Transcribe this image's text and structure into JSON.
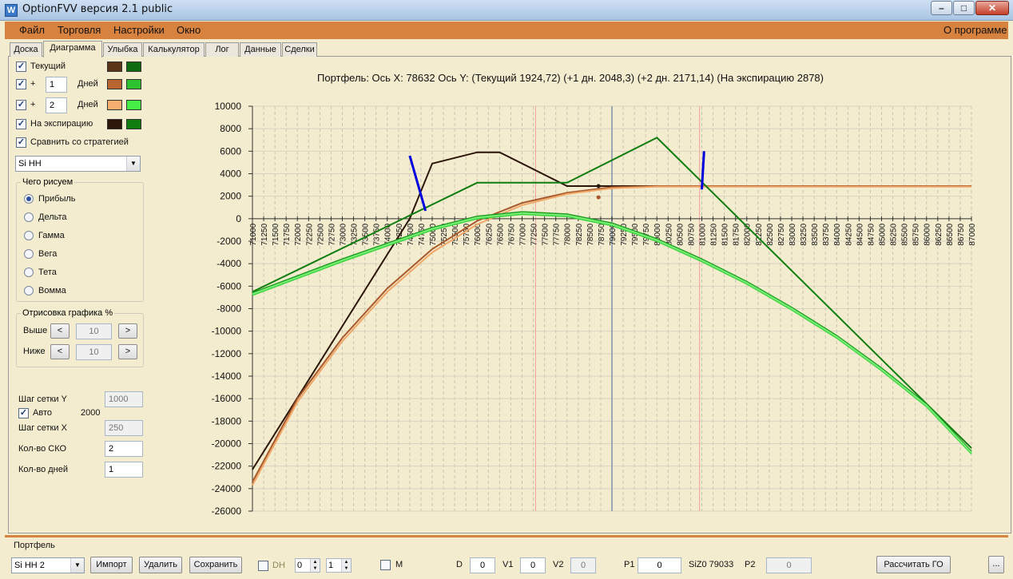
{
  "window": {
    "title": "OptionFVV версия 2.1 public"
  },
  "menu": {
    "items": [
      "Файл",
      "Торговля",
      "Настройки",
      "Окно"
    ],
    "about": "О программе"
  },
  "tabs": [
    "Доска",
    "Диаграмма",
    "Улыбка",
    "Калькулятор",
    "Лог",
    "Данные",
    "Сделки"
  ],
  "active_tab": "Диаграмма",
  "left": {
    "current_label": "Текущий",
    "plus": "+",
    "days_label": "Дней",
    "day1_value": "1",
    "day2_value": "2",
    "expiry_label": "На экспирацию",
    "compare_label": "Сравнить со стратегией",
    "strategy_value": "Si HH",
    "draw_group_title": "Чего рисуем",
    "draw_options": [
      "Прибыль",
      "Дельта",
      "Гамма",
      "Вега",
      "Тета",
      "Вомма"
    ],
    "selected_draw": "Прибыль",
    "render_group_title": "Отрисовка графика %",
    "above_label": "Выше",
    "below_label": "Ниже",
    "above_value": "10",
    "below_value": "10",
    "prev_symbol": "<",
    "next_symbol": ">",
    "grid_y_label": "Шаг сетки Y",
    "grid_y_value": "1000",
    "auto_label": "Авто",
    "auto_value": "2000",
    "grid_x_label": "Шаг сетки X",
    "grid_x_value": "250",
    "sko_label": "Кол-во СКО",
    "sko_value": "2",
    "days_count_label": "Кол-во дней",
    "days_count_value": "1",
    "colors": {
      "current": [
        "#5a3417",
        "#0f6b0f"
      ],
      "day1": [
        "#b8652f",
        "#2fc02f"
      ],
      "day2": [
        "#f5b070",
        "#44ee44"
      ],
      "expiry": [
        "#2b1609",
        "#0f7d0f"
      ]
    }
  },
  "chart_header": "Портфель: Ось X: 78632 Ось Y:  (Текущий 1924,72)  (+1 дн. 2048,3)  (+2 дн. 2171,14)  (На экспирацию 2878)",
  "chart_data": {
    "type": "line",
    "xlabel": "",
    "ylabel": "",
    "xlim": [
      71000,
      87000
    ],
    "ylim": [
      -26000,
      10000
    ],
    "x_ticks": [
      71000,
      71250,
      71500,
      71750,
      72000,
      72250,
      72500,
      72750,
      73000,
      73250,
      73500,
      73750,
      74000,
      74250,
      74500,
      74750,
      75000,
      75250,
      75500,
      75750,
      76000,
      76250,
      76500,
      76750,
      77000,
      77250,
      77500,
      77750,
      78000,
      78250,
      78500,
      78750,
      79000,
      79250,
      79500,
      79750,
      80000,
      80250,
      80500,
      80750,
      81000,
      81250,
      81500,
      81750,
      82000,
      82250,
      82500,
      82750,
      83000,
      83250,
      83500,
      83750,
      84000,
      84250,
      84500,
      84750,
      85000,
      85250,
      85500,
      85750,
      86000,
      86250,
      86500,
      86750,
      87000
    ],
    "y_ticks": [
      10000,
      8000,
      6000,
      4000,
      2000,
      0,
      -2000,
      -4000,
      -6000,
      -8000,
      -10000,
      -12000,
      -14000,
      -16000,
      -18000,
      -20000,
      -22000,
      -24000,
      -26000
    ],
    "vlines": [
      {
        "x": 77300,
        "color": "#f2a0a0"
      },
      {
        "x": 79000,
        "color": "#9aa8b6"
      },
      {
        "x": 80950,
        "color": "#f2a0a0"
      }
    ],
    "series": [
      {
        "color": "#2b1609",
        "points": [
          [
            71000,
            -22300
          ],
          [
            74500,
            0
          ],
          [
            75000,
            4900
          ],
          [
            76000,
            5900
          ],
          [
            76500,
            5900
          ],
          [
            78000,
            2900
          ],
          [
            87000,
            2900
          ]
        ]
      },
      {
        "color": "#a8592b",
        "points": [
          [
            71000,
            -23400
          ],
          [
            72000,
            -16000
          ],
          [
            73000,
            -10600
          ],
          [
            74000,
            -6200
          ],
          [
            75000,
            -2700
          ],
          [
            76000,
            -200
          ],
          [
            77000,
            1400
          ],
          [
            78000,
            2300
          ],
          [
            79000,
            2800
          ],
          [
            80000,
            2900
          ],
          [
            87000,
            2900
          ]
        ]
      },
      {
        "color": "#f0a869",
        "points": [
          [
            71000,
            -23700
          ],
          [
            72000,
            -16300
          ],
          [
            73000,
            -10900
          ],
          [
            74000,
            -6500
          ],
          [
            75000,
            -3000
          ],
          [
            76000,
            -500
          ],
          [
            77000,
            1200
          ],
          [
            78000,
            2200
          ],
          [
            79000,
            2700
          ],
          [
            80000,
            2850
          ],
          [
            87000,
            2850
          ]
        ]
      },
      {
        "color": "#0f7d0f",
        "points": [
          [
            71000,
            -6500
          ],
          [
            76000,
            3200
          ],
          [
            78000,
            3200
          ],
          [
            80000,
            7200
          ],
          [
            87000,
            -20400
          ]
        ]
      },
      {
        "color": "#1c9a1c",
        "points": [
          [
            71000,
            -6600
          ],
          [
            73000,
            -3600
          ],
          [
            75000,
            -800
          ],
          [
            76000,
            200
          ],
          [
            77000,
            600
          ],
          [
            78000,
            400
          ],
          [
            79000,
            -400
          ],
          [
            80000,
            -1800
          ],
          [
            81000,
            -3600
          ],
          [
            82000,
            -5600
          ],
          [
            83000,
            -7900
          ],
          [
            84000,
            -10400
          ],
          [
            85000,
            -13300
          ],
          [
            86000,
            -16500
          ],
          [
            87000,
            -20700
          ]
        ]
      },
      {
        "color": "#3bd33b",
        "points": [
          [
            71000,
            -6800
          ],
          [
            73000,
            -3800
          ],
          [
            75000,
            -1000
          ],
          [
            76000,
            0
          ],
          [
            77000,
            400
          ],
          [
            78000,
            200
          ],
          [
            79000,
            -600
          ],
          [
            80000,
            -2000
          ],
          [
            81000,
            -3800
          ],
          [
            82000,
            -5800
          ],
          [
            83000,
            -8100
          ],
          [
            84000,
            -10600
          ],
          [
            85000,
            -13500
          ],
          [
            86000,
            -16700
          ],
          [
            87000,
            -20900
          ]
        ]
      },
      {
        "color": "#77ee77",
        "points": [
          [
            71000,
            -6700
          ],
          [
            73000,
            -3700
          ],
          [
            75000,
            -900
          ],
          [
            76000,
            100
          ],
          [
            77000,
            500
          ],
          [
            78000,
            300
          ],
          [
            79000,
            -500
          ],
          [
            80000,
            -1900
          ],
          [
            81000,
            -3700
          ],
          [
            82000,
            -5700
          ],
          [
            83000,
            -8000
          ],
          [
            84000,
            -10500
          ],
          [
            85000,
            -13400
          ],
          [
            86000,
            -16600
          ],
          [
            87000,
            -20800
          ]
        ]
      }
    ],
    "markers": [
      {
        "color": "#0000dd",
        "points": [
          [
            74500,
            5600
          ],
          [
            74850,
            700
          ]
        ]
      },
      {
        "color": "#0000dd",
        "points": [
          [
            81050,
            6000
          ],
          [
            81000,
            2600
          ]
        ]
      }
    ]
  },
  "bottom": {
    "portfolio_label": "Портфель",
    "portfolio_value": "Si HH 2",
    "import_label": "Импорт",
    "delete_label": "Удалить",
    "save_label": "Сохранить",
    "dh_label": "DH",
    "spin1_value": "0",
    "spin2_value": "1",
    "m_label": "M",
    "d_label": "D",
    "d_value": "0",
    "v1_label": "V1",
    "v1_value": "0",
    "v2_label": "V2",
    "v2_value": "0",
    "p1_label": "P1",
    "p1_value": "0",
    "siz_label": "SiZ0 79033",
    "p2_label": "P2",
    "p2_value": "0",
    "calc_label": "Рассчитать ГО",
    "more_label": "..."
  }
}
